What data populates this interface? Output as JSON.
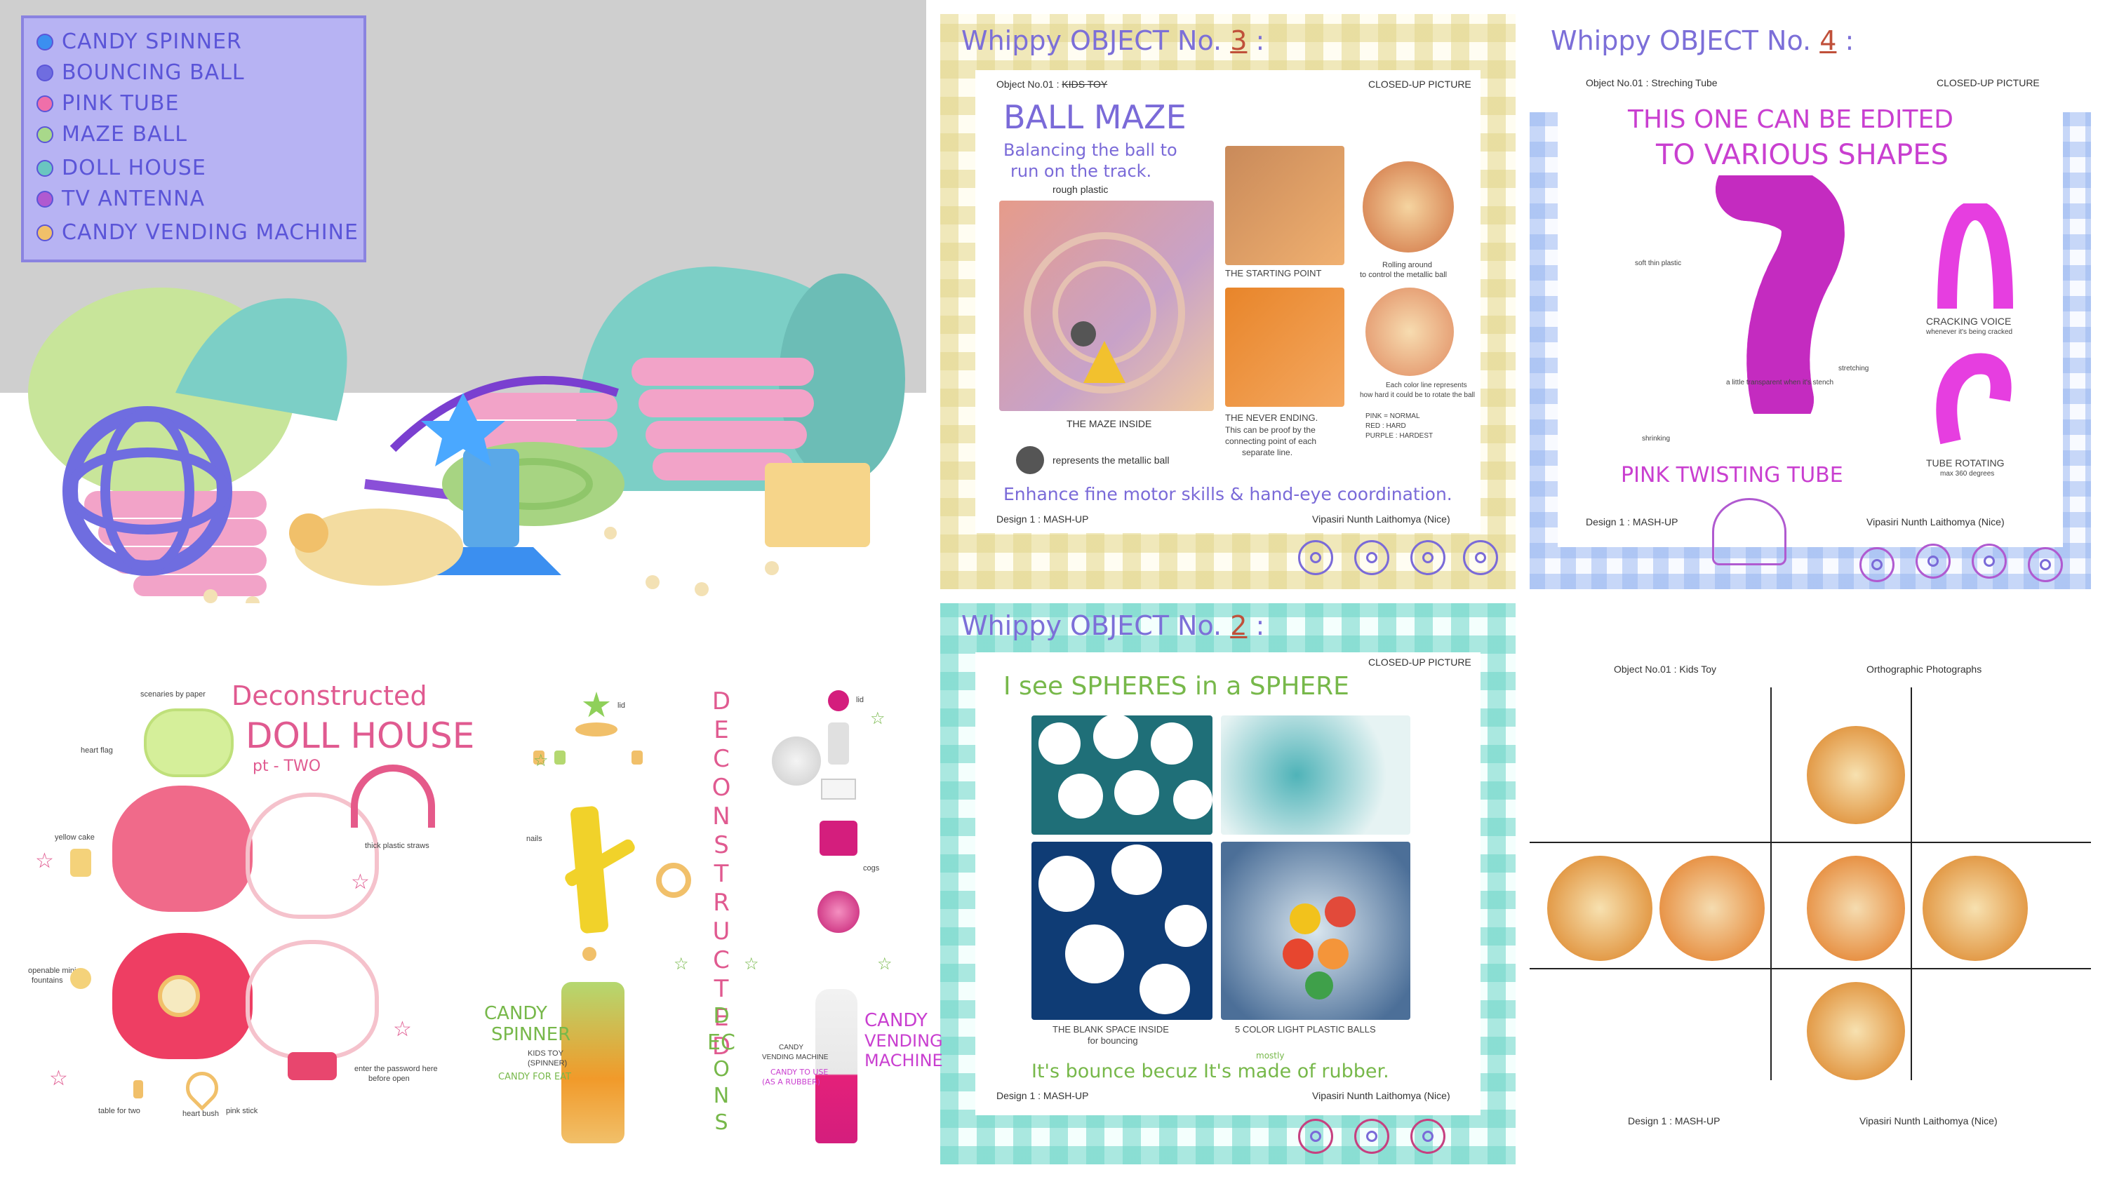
{
  "legend": {
    "items": [
      {
        "label": "CANDY SPINNER",
        "color": "#3b8ff0"
      },
      {
        "label": "BOUNCING BALL",
        "color": "#6f6de0"
      },
      {
        "label": "PINK TUBE",
        "color": "#ef6fa9"
      },
      {
        "label": "MAZE BALL",
        "color": "#a8d88a"
      },
      {
        "label": "DOLL HOUSE",
        "color": "#6ac6c0"
      },
      {
        "label": "TV ANTENNA",
        "color": "#b05ad0"
      },
      {
        "label": "CANDY VENDING MACHINE",
        "color": "#f1c06a"
      }
    ]
  },
  "board3": {
    "title_prefix": "Whippy OBJECT No.",
    "title_num": "3",
    "title_colon": ":",
    "object_label": "Object No.01 : ",
    "object_struck": "KIDS TOY",
    "closed_up": "CLOSED-UP PICTURE",
    "headline": "BALL MAZE",
    "subline1": "Balancing the ball to",
    "subline2": "run on the track.",
    "rough": "rough plastic",
    "starting": "THE STARTING POINT",
    "rolling1": "Rolling around",
    "rolling2": "to control the metallic ball",
    "each_color1": "Each color line represents",
    "each_color2": "how hard it could be to rotate the ball",
    "pink": "PINK = NORMAL",
    "red": "RED : HARD",
    "purple": "PURPLE : HARDEST",
    "maze_inside": "THE  MAZE INSIDE",
    "never1": "THE  NEVER ENDING.",
    "never2": "This can be proof by the",
    "never3": "connecting point of each",
    "never4": "separate line.",
    "metallic": "represents the metallic ball",
    "enhance": "Enhance fine motor skills & hand-eye coordination.",
    "design": "Design 1 : MASH-UP",
    "author": "Vipasiri Nunth Laithomya (Nice)"
  },
  "board4": {
    "title_prefix": "Whippy OBJECT No.",
    "title_num": "4",
    "title_colon": ":",
    "object_label": "Object No.01 : Streching Tube",
    "closed_up": "CLOSED-UP PICTURE",
    "headline1": "THIS ONE CAN BE EDITED",
    "headline2": "TO VARIOUS SHAPES",
    "soft": "soft thin plastic",
    "transparent": "a little transparent when it's stench",
    "stretching": "stretching",
    "shrinking": "shrinking",
    "cracking": "CRACKING VOICE",
    "cracking_sub": "whenever it's being cracked",
    "rotating": "TUBE ROTATING",
    "rotating_sub": "max 360 degrees",
    "pink_tube": "PINK TWISTING TUBE",
    "design": "Design 1 : MASH-UP",
    "author": "Vipasiri Nunth Laithomya (Nice)"
  },
  "board2": {
    "title_prefix": "Whippy OBJECT No.",
    "title_num": "2",
    "title_colon": ":",
    "closed_up": "CLOSED-UP PICTURE",
    "headline": "I see SPHERES in a SPHERE",
    "blank1": "THE BLANK SPACE INSIDE",
    "blank2": "for bouncing",
    "balls": "5 COLOR LIGHT PLASTIC BALLS",
    "bounce": "It's bounce becuz It's made of rubber.",
    "mostly": "mostly",
    "design": "Design 1 : MASH-UP",
    "author": "Vipasiri Nunth Laithomya (Nice)"
  },
  "ortho": {
    "object_label": "Object No.01 : Kids Toy",
    "heading": "Orthographic Photographs",
    "design": "Design 1 : MASH-UP",
    "author": "Vipasiri Nunth Laithomya (Nice)"
  },
  "dollhouse": {
    "title1": "Deconstructed",
    "title2": "DOLL HOUSE",
    "title3": "pt - TWO",
    "scenaries": "scenaries by paper",
    "heart_flag": "heart flag",
    "yellow_cake": "yellow cake",
    "straws": "thick plastic straws",
    "openable1": "openable mini",
    "openable2": "fountains",
    "password1": "enter the password here",
    "password2": "before open",
    "table": "table for two",
    "heart_bush": "heart bush",
    "pink_stick": "pink stick"
  },
  "spinner": {
    "lid": "lid",
    "nails": "nails",
    "candy1": "CANDY",
    "candy2": "SPINNER",
    "kids_toy": "KIDS TOY",
    "spinner_sub": "(SPINNER)",
    "candy_for_eat": "CANDY FOR EAT"
  },
  "deconstructed_vertical": "DECONSTRUCTED",
  "decons_vertical": "DECONS",
  "vending": {
    "lid": "lid",
    "cogs": "cogs",
    "candy1": "CANDY",
    "candy2": "VENDING",
    "candy3": "MACHINE",
    "small1": "CANDY",
    "small2": "VENDING MACHINE",
    "use1": "CANDY TO USE",
    "use2": "(AS A RUBBER)"
  }
}
